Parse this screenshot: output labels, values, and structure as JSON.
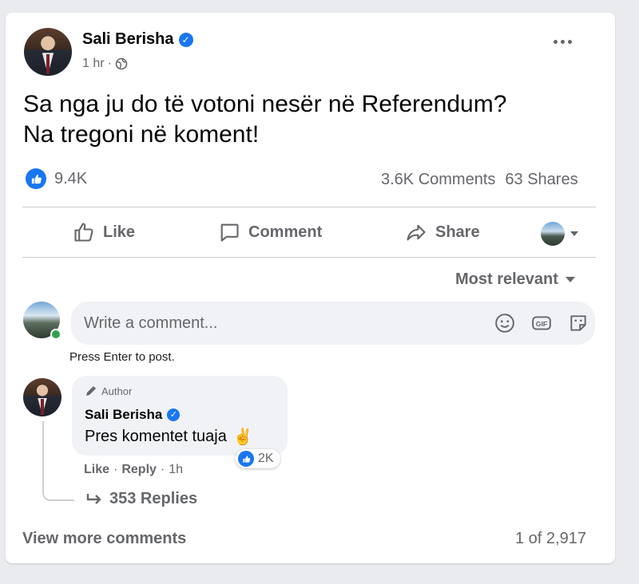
{
  "post": {
    "author": "Sali Berisha",
    "time": "1 hr",
    "time_separator": "·",
    "text": "Sa nga ju do të votoni nesër në Referendum? Na tregoni në koment!",
    "reactions_count": "9.4K",
    "comments_count": "3.6K Comments",
    "shares_count": "63 Shares",
    "more_icon": "ellipsis-icon",
    "privacy_icon": "globe-icon"
  },
  "actions": {
    "like": "Like",
    "comment": "Comment",
    "share": "Share"
  },
  "sort": {
    "label": "Most relevant"
  },
  "composer": {
    "placeholder": "Write a comment...",
    "hint": "Press Enter to post."
  },
  "comment": {
    "badge": "Author",
    "author": "Sali Berisha",
    "text": "Pres komentet tuaja",
    "emoji": "✌️",
    "reactions_count": "2K",
    "like_label": "Like",
    "reply_label": "Reply",
    "time": "1h",
    "replies_label": "353 Replies"
  },
  "footer": {
    "view_more": "View more comments",
    "pagination": "1 of 2,917"
  },
  "colors": {
    "accent": "#1877f2",
    "secondary_text": "#65676b",
    "online": "#31a24c"
  }
}
